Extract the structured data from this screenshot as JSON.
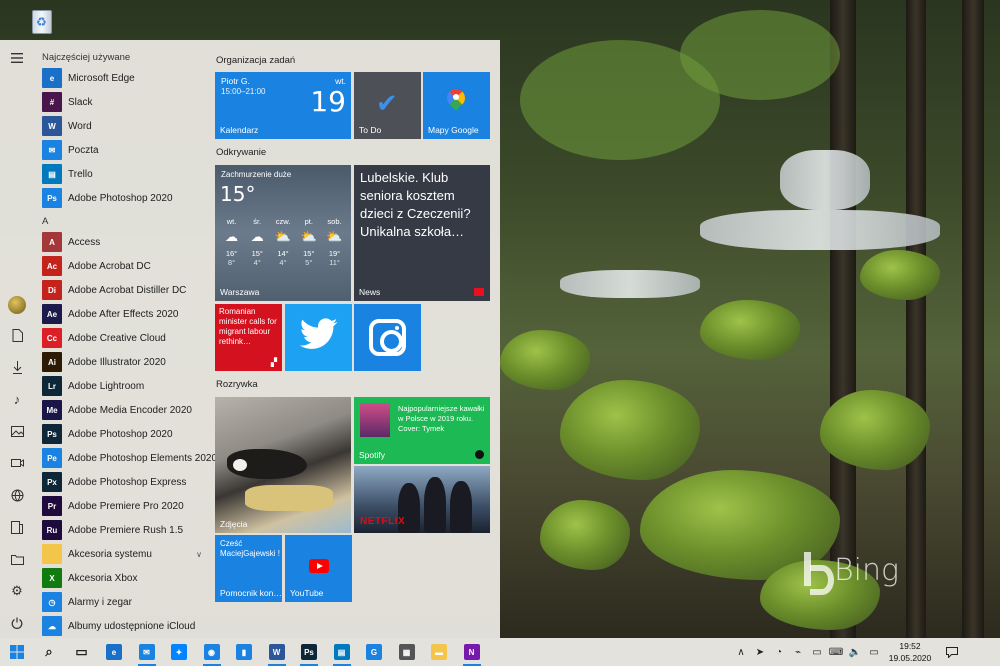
{
  "desktop": {
    "recycle_bin_icon": "recycle-bin-icon",
    "watermark": "Bing"
  },
  "start_menu": {
    "rail": {
      "icons": [
        "hamburger-menu-icon",
        "user-avatar",
        "documents-icon",
        "downloads-icon",
        "music-icon",
        "pictures-icon",
        "videos-icon",
        "network-icon",
        "file-explorer-icon",
        "personal-folder-icon",
        "settings-icon",
        "power-icon"
      ]
    },
    "most_used_header": "Najczęściej używane",
    "most_used": [
      {
        "label": "Microsoft Edge",
        "icon": "edge-icon",
        "color": "#1a6fc9"
      },
      {
        "label": "Slack",
        "icon": "slack-icon",
        "color": "#4a154b"
      },
      {
        "label": "Word",
        "icon": "word-icon",
        "color": "#2b579a"
      },
      {
        "label": "Poczta",
        "icon": "mail-icon",
        "color": "#1a82e0"
      },
      {
        "label": "Trello",
        "icon": "trello-icon",
        "color": "#0079bf"
      },
      {
        "label": "Adobe Photoshop 2020",
        "icon": "photoshop-icon",
        "color": "#1a82e0"
      }
    ],
    "letter_a": "A",
    "apps_a": [
      {
        "label": "Access",
        "icon": "access-icon",
        "color": "#a4373a",
        "glyph": "A"
      },
      {
        "label": "Adobe Acrobat DC",
        "icon": "acrobat-icon",
        "color": "#c4231c",
        "glyph": "Ac"
      },
      {
        "label": "Adobe Acrobat Distiller DC",
        "icon": "acrobat-distiller-icon",
        "color": "#c4231c",
        "glyph": "Di"
      },
      {
        "label": "Adobe After Effects 2020",
        "icon": "after-effects-icon",
        "color": "#1c1a4b",
        "glyph": "Ae"
      },
      {
        "label": "Adobe Creative Cloud",
        "icon": "creative-cloud-icon",
        "color": "#da1f26",
        "glyph": "Cc"
      },
      {
        "label": "Adobe Illustrator 2020",
        "icon": "illustrator-icon",
        "color": "#2d1a05",
        "glyph": "Ai"
      },
      {
        "label": "Adobe Lightroom",
        "icon": "lightroom-icon",
        "color": "#0d2638",
        "glyph": "Lr"
      },
      {
        "label": "Adobe Media Encoder 2020",
        "icon": "media-encoder-icon",
        "color": "#1a1748",
        "glyph": "Me"
      },
      {
        "label": "Adobe Photoshop 2020",
        "icon": "photoshop-icon",
        "color": "#0d2638",
        "glyph": "Ps"
      },
      {
        "label": "Adobe Photoshop Elements 2020",
        "icon": "photoshop-elements-icon",
        "color": "#1a82e0",
        "glyph": "Pe"
      },
      {
        "label": "Adobe Photoshop Express",
        "icon": "photoshop-express-icon",
        "color": "#0d2638",
        "glyph": "Px"
      },
      {
        "label": "Adobe Premiere Pro 2020",
        "icon": "premiere-pro-icon",
        "color": "#1e0a3c",
        "glyph": "Pr"
      },
      {
        "label": "Adobe Premiere Rush 1.5",
        "icon": "premiere-rush-icon",
        "color": "#1e0a3c",
        "glyph": "Ru"
      },
      {
        "label": "Akcesoria systemu",
        "icon": "folder-icon",
        "color": "#f3c64b",
        "glyph": "",
        "expandable": true
      },
      {
        "label": "Akcesoria Xbox",
        "icon": "xbox-icon",
        "color": "#107c10",
        "glyph": "X"
      },
      {
        "label": "Alarmy i zegar",
        "icon": "alarm-clock-icon",
        "color": "#1a82e0",
        "glyph": "◷"
      },
      {
        "label": "Albumy udostępnione iCloud",
        "icon": "icloud-icon",
        "color": "#1a82e0",
        "glyph": "☁"
      }
    ]
  },
  "tiles": {
    "group1_title": "Organizacja zadań",
    "calendar": {
      "user": "Piotr G.",
      "time": "15:00–21:00",
      "weekday": "wt.",
      "day": "19",
      "label": "Kalendarz"
    },
    "todo": {
      "label": "To Do"
    },
    "maps": {
      "label": "Mapy Google"
    },
    "group2_title": "Odkrywanie",
    "weather": {
      "condition": "Zachmurzenie duże",
      "temp": "15°",
      "location": "Warszawa",
      "days": [
        {
          "day": "wt.",
          "hi": "16°",
          "lo": "8°",
          "icon": "cloud"
        },
        {
          "day": "śr.",
          "hi": "15°",
          "lo": "4°",
          "icon": "cloud"
        },
        {
          "day": "czw.",
          "hi": "14°",
          "lo": "4°",
          "icon": "partly-sunny"
        },
        {
          "day": "pt.",
          "hi": "15°",
          "lo": "5°",
          "icon": "partly-sunny"
        },
        {
          "day": "sob.",
          "hi": "19°",
          "lo": "11°",
          "icon": "partly-sunny"
        }
      ]
    },
    "news": {
      "headline": "Lubelskie. Klub seniora kosztem dzieci z Czeczenii? Unikalna szkoła…",
      "label": "News"
    },
    "redlabel": {
      "headline": "Romanian minister calls for migrant labour rethink…"
    },
    "twitter": {
      "icon": "twitter-bird-icon"
    },
    "instagram": {
      "icon": "instagram-icon"
    },
    "group3_title": "Rozrywka",
    "photos": {
      "label": "Zdjęcia"
    },
    "spotify": {
      "text": "Najpopularniejsze kawałki w Polsce w 2019 roku. Cover: Tymek",
      "label": "Spotify"
    },
    "netflix": {
      "logo": "NETFLIX"
    },
    "cortana": {
      "text": "Cześć MaciejGajewski !",
      "label": "Pomocnik kon…"
    },
    "youtube": {
      "label": "YouTube"
    }
  },
  "taskbar": {
    "apps": [
      {
        "name": "search",
        "icon": "search-icon",
        "color": "#ffffff",
        "active": false
      },
      {
        "name": "task-view",
        "icon": "task-view-icon",
        "color": "#ffffff",
        "active": false
      },
      {
        "name": "edge",
        "icon": "edge-icon",
        "color": "#1a6fc9",
        "active": false
      },
      {
        "name": "mail",
        "icon": "mail-icon",
        "color": "#1a82e0",
        "active": true
      },
      {
        "name": "messenger",
        "icon": "messenger-icon",
        "color": "#0084ff",
        "active": false
      },
      {
        "name": "settings-chrome",
        "icon": "chrome-icon",
        "color": "#1a82e0",
        "active": true
      },
      {
        "name": "phone",
        "icon": "phone-icon",
        "color": "#1a82e0",
        "active": false
      },
      {
        "name": "word",
        "icon": "word-icon",
        "color": "#2b579a",
        "active": true
      },
      {
        "name": "photoshop",
        "icon": "photoshop-icon",
        "color": "#0d2638",
        "active": true
      },
      {
        "name": "trello",
        "icon": "trello-icon",
        "color": "#0079bf",
        "active": true
      },
      {
        "name": "translator",
        "icon": "translate-icon",
        "color": "#1a82e0",
        "active": false
      },
      {
        "name": "calculator",
        "icon": "calculator-icon",
        "color": "#555555",
        "active": false
      },
      {
        "name": "file-explorer",
        "icon": "folder-icon",
        "color": "#f3c64b",
        "active": false
      },
      {
        "name": "onenote",
        "icon": "onenote-icon",
        "color": "#7719aa",
        "active": true
      }
    ],
    "tray_icons": [
      "chevron-up-icon",
      "telegram-icon",
      "volume-icon",
      "network-icon",
      "battery-icon",
      "keyboard-icon",
      "speaker-icon",
      "display-icon"
    ],
    "time": "19:52",
    "date": "19.05.2020"
  }
}
